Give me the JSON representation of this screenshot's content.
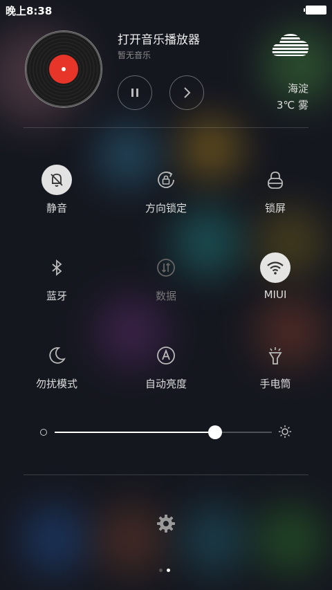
{
  "status_bar": {
    "time": "晚上8:38"
  },
  "music": {
    "title": "打开音乐播放器",
    "subtitle": "暂无音乐"
  },
  "weather": {
    "city": "海淀",
    "temp": "3℃ 雾"
  },
  "toggles": [
    {
      "label": "静音",
      "icon": "bell-off-icon",
      "active": true
    },
    {
      "label": "方向锁定",
      "icon": "rotation-lock-icon",
      "active": false
    },
    {
      "label": "锁屏",
      "icon": "lock-icon",
      "active": false
    },
    {
      "label": "蓝牙",
      "icon": "bluetooth-icon",
      "active": false
    },
    {
      "label": "数据",
      "icon": "data-icon",
      "active": false,
      "disabled": true
    },
    {
      "label": "MIUI",
      "icon": "wifi-icon",
      "active": true
    },
    {
      "label": "勿扰模式",
      "icon": "moon-icon",
      "active": false
    },
    {
      "label": "自动亮度",
      "icon": "auto-brightness-icon",
      "active": false
    },
    {
      "label": "手电筒",
      "icon": "flashlight-icon",
      "active": false
    }
  ],
  "brightness": {
    "level": 0.74
  },
  "pager": {
    "pages": 2,
    "current": 2
  },
  "colors": {
    "record_label": "#e8352a",
    "accent": "#ffffff"
  }
}
